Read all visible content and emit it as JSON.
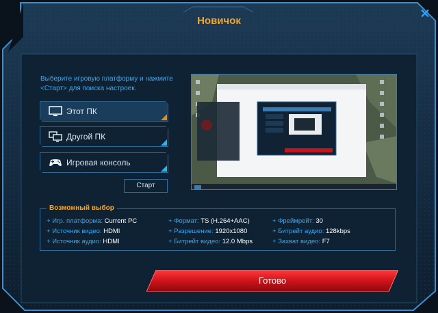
{
  "dialog": {
    "title": "Новичок",
    "close_glyph": "✕",
    "instruction": "Выберите игровую платформу и нажмите <Старт> для поиска настроек.",
    "platforms": [
      {
        "label": "Этот ПК",
        "icon": "monitor-icon",
        "selected": true
      },
      {
        "label": "Другой ПК",
        "icon": "dual-monitor-icon",
        "selected": false
      },
      {
        "label": "Игровая консоль",
        "icon": "gamepad-icon",
        "selected": false
      }
    ],
    "start_label": "Старт",
    "summary": {
      "title": "Возможный выбор",
      "options": [
        {
          "key": "Игр. платформа:",
          "value": "Current PC"
        },
        {
          "key": "Источник видео:",
          "value": "HDMI"
        },
        {
          "key": "Источник аудио:",
          "value": "HDMI"
        },
        {
          "key": "Формат:",
          "value": "TS (H.264+AAC)"
        },
        {
          "key": "Разрешение:",
          "value": "1920x1080"
        },
        {
          "key": "Битрейт видео:",
          "value": "12.0 Mbps"
        },
        {
          "key": "Фреймрейт:",
          "value": "30"
        },
        {
          "key": "Битрейт аудио:",
          "value": "128kbps"
        },
        {
          "key": "Захват видео:",
          "value": "F7"
        }
      ]
    },
    "done_label": "Готово"
  },
  "colors": {
    "accent_orange": "#f5a623",
    "accent_blue": "#3aa7ef",
    "frame_blue": "#2a6ea0",
    "panel_bg": "#0f2233",
    "done_red": "#c8141c"
  }
}
